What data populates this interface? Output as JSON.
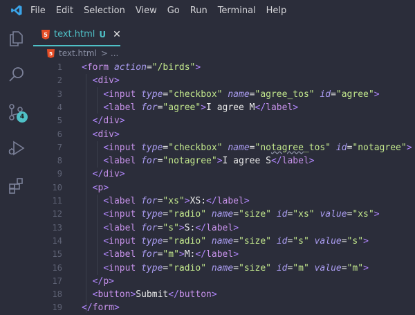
{
  "menubar": {
    "items": [
      "File",
      "Edit",
      "Selection",
      "View",
      "Go",
      "Run",
      "Terminal",
      "Help"
    ]
  },
  "activity_bar": {
    "icons": [
      "explorer-icon",
      "search-icon",
      "source-control-icon",
      "run-debug-icon",
      "extensions-icon"
    ],
    "scm_badge": "4",
    "colors": {
      "active": "#4fc1c7",
      "inactive": "#7b8098"
    }
  },
  "tab": {
    "filename": "text.html",
    "status": "U",
    "close": "✕"
  },
  "breadcrumb": {
    "file": "text.html",
    "separator": ">",
    "rest": "..."
  },
  "editor": {
    "line_numbers": [
      "1",
      "2",
      "3",
      "4",
      "5",
      "6",
      "7",
      "8",
      "9",
      "10",
      "11",
      "12",
      "13",
      "14",
      "15",
      "16",
      "17",
      "18",
      "19"
    ]
  },
  "colors": {
    "background": "#2b2d3a",
    "accent": "#4fc1c7",
    "tag": "#c792ea",
    "attribute": "#ab9df2",
    "string": "#c3e88d"
  }
}
